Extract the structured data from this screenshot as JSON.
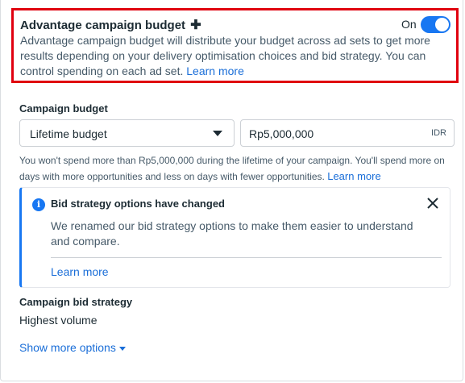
{
  "advantage": {
    "title": "Advantage campaign budget",
    "plus_icon": "plus-icon",
    "toggle_label": "On",
    "toggle_on": true,
    "description": "Advantage campaign budget will distribute your budget across ad sets to get more results depending on your delivery optimisation choices and bid strategy. You can control spending on each ad set.",
    "learn_more": "Learn more"
  },
  "campaign_budget": {
    "label": "Campaign budget",
    "budget_type": "Lifetime budget",
    "amount": "Rp5,000,000",
    "currency": "IDR",
    "note": "You won't spend more than Rp5,000,000 during the lifetime of your campaign. You'll spend more on days with more opportunities and less on days with fewer opportunities.",
    "learn_more": "Learn more"
  },
  "notice": {
    "icon": "info-icon",
    "title": "Bid strategy options have changed",
    "body": "We renamed our bid strategy options to make them easier to understand and compare.",
    "learn_more": "Learn more"
  },
  "bid_strategy": {
    "label": "Campaign bid strategy",
    "value": "Highest volume"
  },
  "show_more": "Show more options",
  "colors": {
    "highlight_border": "#e0000f",
    "accent": "#1877f2",
    "link": "#1a6ed8"
  }
}
